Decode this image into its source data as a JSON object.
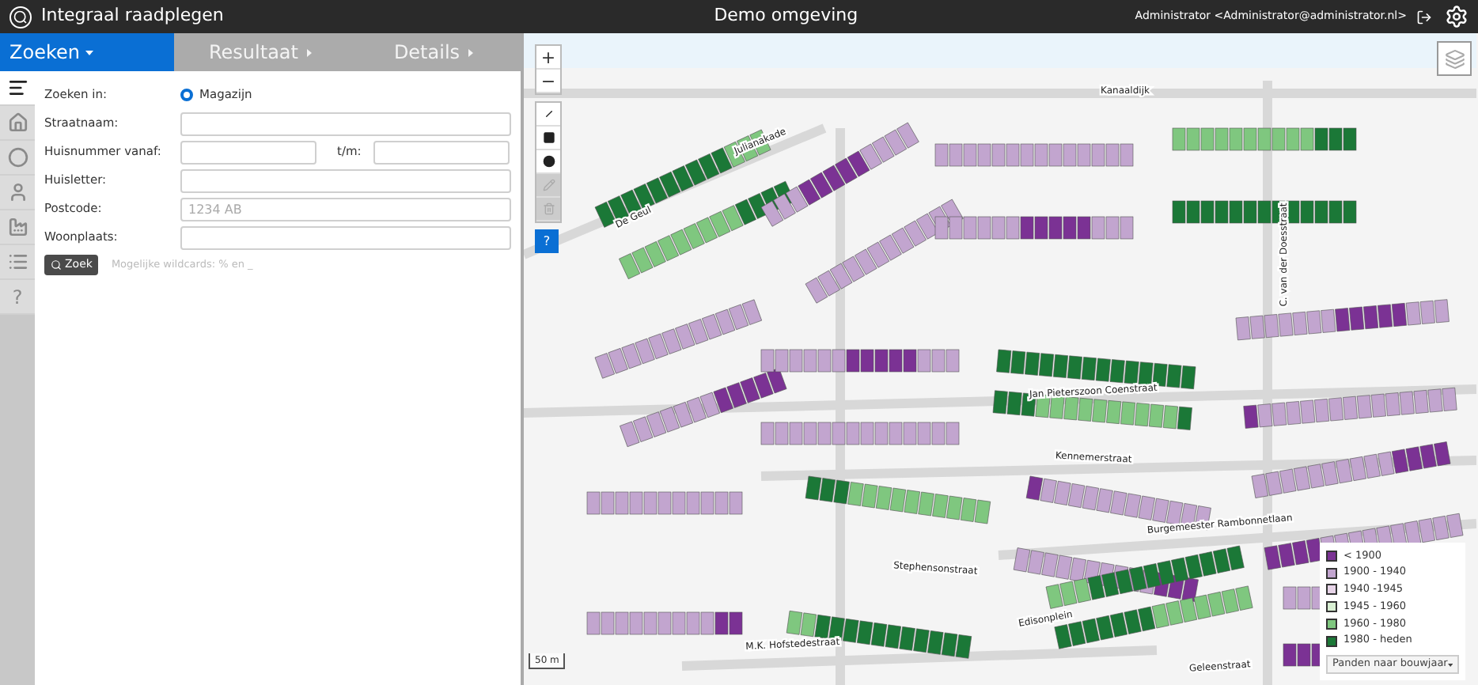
{
  "header": {
    "title": "Integraal raadplegen",
    "environment": "Demo omgeving",
    "user": "Administrator <Administrator@administrator.nl>"
  },
  "tabs": [
    {
      "label": "Zoeken",
      "selected": true
    },
    {
      "label": "Resultaat",
      "selected": false
    },
    {
      "label": "Details",
      "selected": false
    }
  ],
  "sidebar": [
    {
      "kind": "menu",
      "selected": true
    },
    {
      "kind": "home",
      "selected": false
    },
    {
      "kind": "circle",
      "selected": false
    },
    {
      "kind": "person",
      "selected": false
    },
    {
      "kind": "factory",
      "selected": false
    },
    {
      "kind": "list",
      "selected": false
    },
    {
      "kind": "help",
      "label": "?",
      "selected": false
    }
  ],
  "form": {
    "search_in": {
      "label": "Zoeken in:",
      "option": "Magazijn",
      "selected": true
    },
    "fields": [
      {
        "kind": "single",
        "label": "Straatnaam:"
      },
      {
        "kind": "range",
        "label": "Huisnummer vanaf:",
        "to_label": "t/m:"
      },
      {
        "kind": "single",
        "label": "Huisletter:"
      },
      {
        "kind": "single",
        "label": "Postcode:",
        "placeholder": "1234 AB"
      },
      {
        "kind": "single",
        "label": "Woonplaats:"
      }
    ],
    "button": "Zoek",
    "hint": "Mogelijke wildcards: % en _"
  },
  "map": {
    "zoom": [
      "+",
      "−"
    ],
    "tools": [
      {
        "kind": "line",
        "disabled": false
      },
      {
        "kind": "square",
        "disabled": false
      },
      {
        "kind": "dot",
        "disabled": false
      },
      {
        "kind": "edit",
        "disabled": true
      },
      {
        "kind": "trash",
        "disabled": true
      }
    ],
    "help": "?",
    "street_labels": [
      "Kanaaldijk",
      "De Geul",
      "Julianakade",
      "C. van der Doesstraat",
      "Jan Pieterszoon Coenstraat",
      "Kennemerstraat",
      "Stephensonstraat",
      "Burgemeester Rambonnetlaan",
      "M.K. Hofstedestraat",
      "Edisonplein",
      "Geleenstraat"
    ],
    "scale": "50 m",
    "legend": {
      "items": [
        {
          "label": "< 1900",
          "color": "#7b3294"
        },
        {
          "label": "1900 - 1940",
          "color": "#c2a5cf"
        },
        {
          "label": "1940 -1945",
          "color": "#e7d4e8"
        },
        {
          "label": "1945 - 1960",
          "color": "#d9f0d3"
        },
        {
          "label": "1960 - 1980",
          "color": "#7fc77f"
        },
        {
          "label": "1980 - heden",
          "color": "#1b7837"
        }
      ],
      "dropdown": "Panden naar bouwjaar"
    }
  }
}
